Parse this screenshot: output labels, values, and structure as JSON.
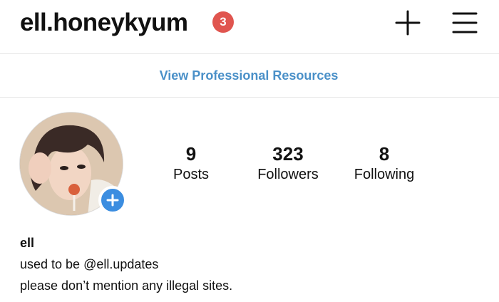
{
  "header": {
    "username": "ell.honeykyum",
    "notification_count": "3",
    "icons": {
      "new_post": "plus-icon",
      "menu": "hamburger-menu-icon"
    }
  },
  "pro_bar": {
    "link_label": "View Professional Resources"
  },
  "profile": {
    "avatar_icon": "add-story-icon",
    "stats": {
      "posts": {
        "value": "9",
        "label": "Posts"
      },
      "followers": {
        "value": "323",
        "label": "Followers"
      },
      "following": {
        "value": "8",
        "label": "Following"
      }
    },
    "bio": {
      "name": "ell",
      "lines": [
        "used to be @ell.updates",
        "please don’t mention any illegal sites."
      ]
    }
  },
  "colors": {
    "badge": "#e0554f",
    "link": "#4a90c8",
    "add_story": "#3b8de0"
  }
}
